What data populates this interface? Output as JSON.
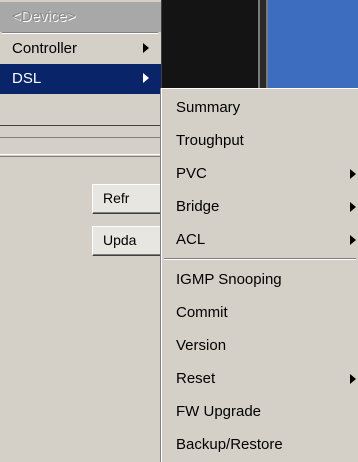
{
  "colors": {
    "menu_bg": "#d4d0c8",
    "selection": "#0a246a",
    "background_blue": "#3c6dbf",
    "background_dark": "#141414"
  },
  "main_menu": {
    "items": [
      {
        "label": "<Device>",
        "state": "disabled",
        "has_submenu": false
      },
      {
        "label": "Controller",
        "state": "normal",
        "has_submenu": true
      },
      {
        "label": "DSL",
        "state": "selected",
        "has_submenu": true
      }
    ]
  },
  "dsl_submenu": {
    "items": [
      {
        "label": "Summary",
        "has_submenu": false
      },
      {
        "label": "Troughput",
        "has_submenu": false
      },
      {
        "label": "PVC",
        "has_submenu": true
      },
      {
        "label": "Bridge",
        "has_submenu": true
      },
      {
        "label": "ACL",
        "has_submenu": true
      },
      {
        "label": "IGMP Snooping",
        "has_submenu": false
      },
      {
        "label": "Commit",
        "has_submenu": false
      },
      {
        "label": "Version",
        "has_submenu": false
      },
      {
        "label": "Reset",
        "has_submenu": true
      },
      {
        "label": "FW Upgrade",
        "has_submenu": false
      },
      {
        "label": "Backup/Restore",
        "has_submenu": false
      }
    ]
  },
  "panel": {
    "refresh_label": "Refr",
    "update_label": "Upda"
  }
}
